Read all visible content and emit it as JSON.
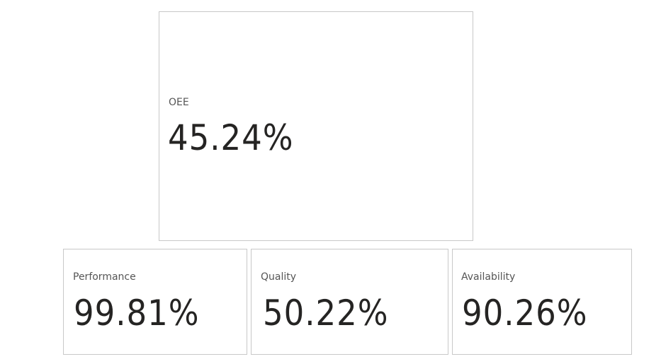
{
  "cards": {
    "oee": {
      "label": "OEE",
      "value": "45.24%"
    },
    "performance": {
      "label": "Performance",
      "value": "99.81%"
    },
    "quality": {
      "label": "Quality",
      "value": "50.22%"
    },
    "availability": {
      "label": "Availability",
      "value": "90.26%"
    }
  },
  "colors": {
    "card_border": "#c8c8c8",
    "label_text": "#555555",
    "value_text": "#252423",
    "background": "#ffffff"
  }
}
